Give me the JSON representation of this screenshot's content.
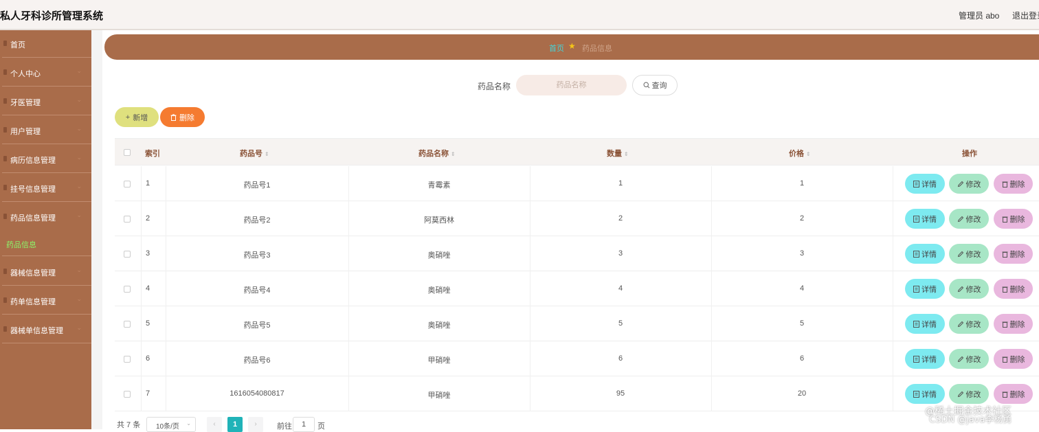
{
  "header": {
    "title": "私人牙科诊所管理系统",
    "admin": "管理员 abo",
    "logout": "退出登录"
  },
  "sidebar": {
    "items": [
      {
        "label": "首页",
        "has_arrow": false
      },
      {
        "label": "个人中心",
        "has_arrow": true
      },
      {
        "label": "牙医管理",
        "has_arrow": true
      },
      {
        "label": "用户管理",
        "has_arrow": true
      },
      {
        "label": "病历信息管理",
        "has_arrow": true
      },
      {
        "label": "挂号信息管理",
        "has_arrow": true
      },
      {
        "label": "药品信息管理",
        "has_arrow": true
      },
      {
        "label": "器械信息管理",
        "has_arrow": true
      },
      {
        "label": "药单信息管理",
        "has_arrow": true
      },
      {
        "label": "器械单信息管理",
        "has_arrow": true
      }
    ],
    "active_sub": "药品信息",
    "arrow": "⌄"
  },
  "breadcrumb": {
    "home": "首页",
    "star": "★",
    "current": "药品信息"
  },
  "search": {
    "label": "药品名称",
    "placeholder": "药品名称",
    "button": "查询",
    "button_icon": "search-icon"
  },
  "actions": {
    "add": "新增",
    "add_icon": "+",
    "delete": "删除",
    "delete_icon": "trash-icon"
  },
  "table": {
    "headers": {
      "index": "索引",
      "code": "药品号",
      "name": "药品名称",
      "quantity": "数量",
      "price": "价格",
      "ops": "操作"
    },
    "sort_icon": "⇕",
    "rows": [
      {
        "index": "1",
        "code": "药品号1",
        "name": "青霉素",
        "quantity": "1",
        "price": "1"
      },
      {
        "index": "2",
        "code": "药品号2",
        "name": "阿莫西林",
        "quantity": "2",
        "price": "2"
      },
      {
        "index": "3",
        "code": "药品号3",
        "name": "奥硝唑",
        "quantity": "3",
        "price": "3"
      },
      {
        "index": "4",
        "code": "药品号4",
        "name": "奥硝唑",
        "quantity": "4",
        "price": "4"
      },
      {
        "index": "5",
        "code": "药品号5",
        "name": "奥硝唑",
        "quantity": "5",
        "price": "5"
      },
      {
        "index": "6",
        "code": "药品号6",
        "name": "甲硝唑",
        "quantity": "6",
        "price": "6"
      },
      {
        "index": "7",
        "code": "1616054080817",
        "name": "甲硝唑",
        "quantity": "95",
        "price": "20"
      }
    ],
    "op_labels": {
      "detail": "详情",
      "edit": "修改",
      "delete": "删除"
    }
  },
  "pagination": {
    "total": "共 7 条",
    "page_size": "10条/页",
    "current_page": "1",
    "goto_label": "前往",
    "goto_value": "1",
    "goto_suffix": "页",
    "prev": "‹",
    "next": "›"
  },
  "watermark": {
    "line1": "@稀土掘金技术社区",
    "line2": "CSDN @java李杨勇"
  },
  "colors": {
    "brand": "#a96c4a",
    "active_menu": "#8cf36a",
    "page_active": "#20b3b8"
  }
}
